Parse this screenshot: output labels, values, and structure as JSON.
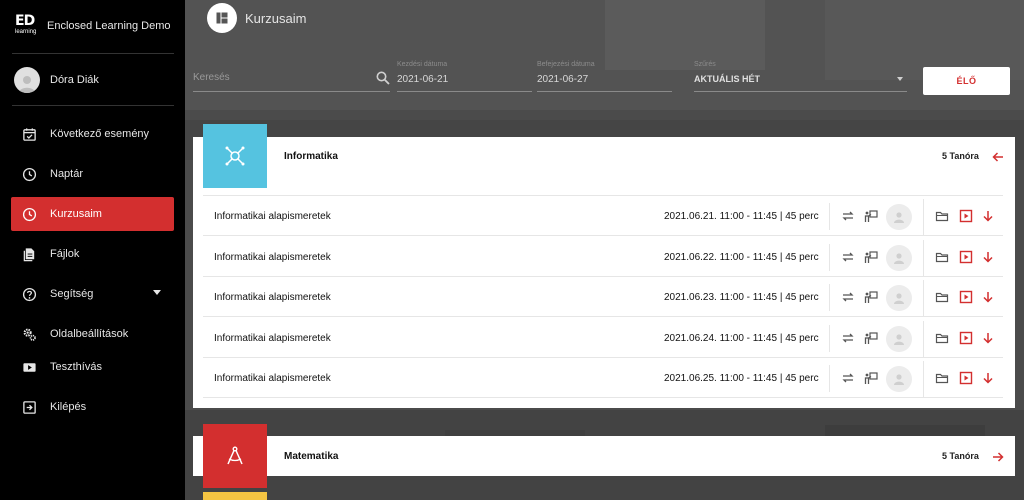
{
  "app": {
    "logo_top": "ED",
    "logo_bottom": "learning",
    "name": "Enclosed Learning Demo"
  },
  "user": {
    "name": "Dóra Diák"
  },
  "nav": [
    {
      "label": "Következő esemény",
      "icon": "calendar-check-icon"
    },
    {
      "label": "Naptár",
      "icon": "clock-icon"
    },
    {
      "label": "Kurzusaim",
      "icon": "clock-icon",
      "active": true
    },
    {
      "label": "Fájlok",
      "icon": "file-icon"
    },
    {
      "label": "Segítség",
      "icon": "help-icon"
    },
    {
      "label": "Oldalbeállítások",
      "icon": "gears-icon"
    },
    {
      "label": "Teszthívás",
      "icon": "video-icon"
    },
    {
      "label": "Kilépés",
      "icon": "logout-icon"
    }
  ],
  "header": {
    "title": "Kurzusaim",
    "icon": "dashboard-icon"
  },
  "filters": {
    "search_placeholder": "Keresés",
    "start_label": "Kezdési dátuma",
    "start_value": "2021-06-21",
    "end_label": "Befejezési dátuma",
    "end_value": "2021-06-27",
    "filter_label": "Szűrés",
    "filter_value": "AKTUÁLIS HÉT",
    "live_button": "ÉLŐ"
  },
  "courses": [
    {
      "title": "Informatika",
      "count": "5 Tanóra",
      "color": "#55c3e0",
      "expanded": true,
      "lessons": [
        {
          "title": "Informatikai alapismeretek",
          "time": "2021.06.21. 11:00 - 11:45 | 45 perc"
        },
        {
          "title": "Informatikai alapismeretek",
          "time": "2021.06.22. 11:00 - 11:45 | 45 perc"
        },
        {
          "title": "Informatikai alapismeretek",
          "time": "2021.06.23. 11:00 - 11:45 | 45 perc"
        },
        {
          "title": "Informatikai alapismeretek",
          "time": "2021.06.24. 11:00 - 11:45 | 45 perc"
        },
        {
          "title": "Informatikai alapismeretek",
          "time": "2021.06.25. 11:00 - 11:45 | 45 perc"
        }
      ]
    },
    {
      "title": "Matematika",
      "count": "5 Tanóra",
      "color": "#d32f2f",
      "expanded": false
    },
    {
      "color": "#f5c542"
    }
  ],
  "colors": {
    "accent": "#d32f2f",
    "sidebar_bg": "#000000",
    "icon_gray": "#555555"
  }
}
